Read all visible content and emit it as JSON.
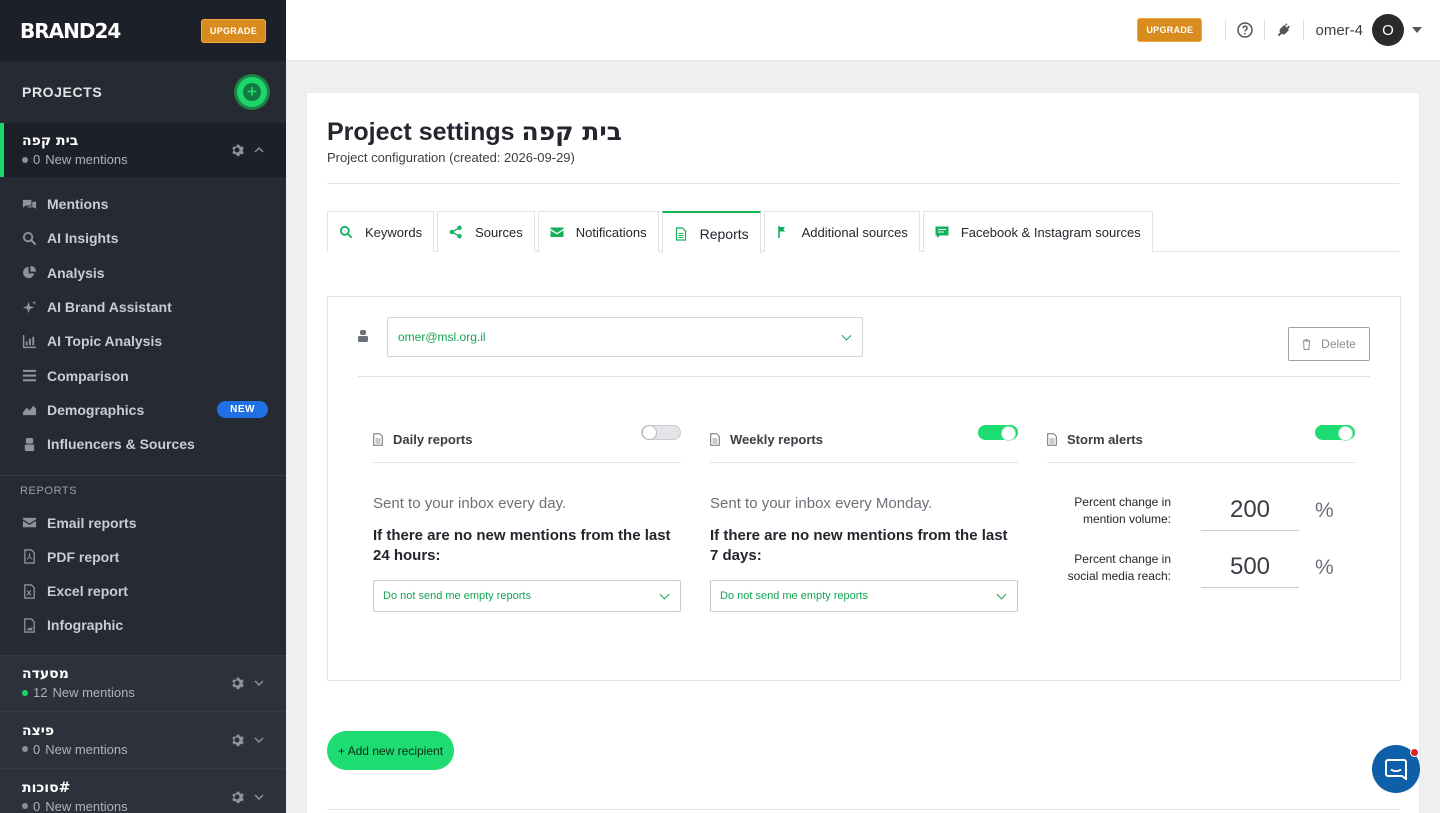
{
  "sidebar": {
    "brand": "BRAND24",
    "upgrade_label": "UPGRADE",
    "projects_title": "PROJECTS",
    "active_project": {
      "name": "בית קפה",
      "count": "0",
      "mentions_label": "New mentions"
    },
    "nav": [
      {
        "label": "Mentions",
        "icon": "chat-bubbles-icon"
      },
      {
        "label": "AI Insights",
        "icon": "ai-search-icon"
      },
      {
        "label": "Analysis",
        "icon": "pie-chart-icon"
      },
      {
        "label": "AI Brand Assistant",
        "icon": "sparkle-icon"
      },
      {
        "label": "AI Topic Analysis",
        "icon": "bar-chart-icon"
      },
      {
        "label": "Comparison",
        "icon": "list-icon"
      },
      {
        "label": "Demographics",
        "icon": "area-chart-icon",
        "badge": "NEW"
      },
      {
        "label": "Influencers & Sources",
        "icon": "person-icon"
      }
    ],
    "reports_label": "REPORTS",
    "reports": [
      {
        "label": "Email reports",
        "icon": "envelope-icon"
      },
      {
        "label": "PDF report",
        "icon": "pdf-file-icon"
      },
      {
        "label": "Excel report",
        "icon": "excel-file-icon"
      },
      {
        "label": "Infographic",
        "icon": "image-icon"
      }
    ],
    "other_projects": [
      {
        "name": "מסעדה",
        "count": "12",
        "mentions_label": "New mentions",
        "active_dot": true
      },
      {
        "name": "פיצה",
        "count": "0",
        "mentions_label": "New mentions",
        "active_dot": false
      },
      {
        "name": "#סוכות",
        "count": "0",
        "mentions_label": "New mentions",
        "active_dot": false
      }
    ]
  },
  "topbar": {
    "upgrade_label": "UPGRADE",
    "username": "omer-4",
    "avatar_letter": "O"
  },
  "page": {
    "title_prefix": "Project settings",
    "title_project": "בית קפה",
    "subtitle": "Project configuration (created: 2026-09-29)",
    "tabs": [
      {
        "label": "Keywords",
        "icon": "search-icon"
      },
      {
        "label": "Sources",
        "icon": "share-icon"
      },
      {
        "label": "Notifications",
        "icon": "envelope-icon"
      },
      {
        "label": "Reports",
        "icon": "document-icon",
        "active": true
      },
      {
        "label": "Additional sources",
        "icon": "flag-icon"
      },
      {
        "label": "Facebook & Instagram sources",
        "icon": "comment-icon"
      }
    ]
  },
  "reports_panel": {
    "recipient_email": "omer@msl.org.il",
    "delete_label": "Delete",
    "daily": {
      "title": "Daily reports",
      "enabled": false,
      "desc": "Sent to your inbox every day.",
      "condition": "If there are no new mentions from the last 24 hours:",
      "select_value": "Do not send me empty reports"
    },
    "weekly": {
      "title": "Weekly reports",
      "enabled": true,
      "desc": "Sent to your inbox every Monday.",
      "condition": "If there are no new mentions from the last 7 days:",
      "select_value": "Do not send me empty reports"
    },
    "storm": {
      "title": "Storm alerts",
      "enabled": true,
      "volume_label": "Percent change in mention volume:",
      "volume_value": "200",
      "reach_label": "Percent change in social media reach:",
      "reach_value": "500",
      "unit": "%"
    },
    "add_recipient_label": "+ Add new recipient"
  },
  "colors": {
    "accent_green": "#1ddc72",
    "sidebar_bg": "#262a33",
    "upgrade_orange": "#d98c1e",
    "new_badge_blue": "#1f6fe5"
  }
}
